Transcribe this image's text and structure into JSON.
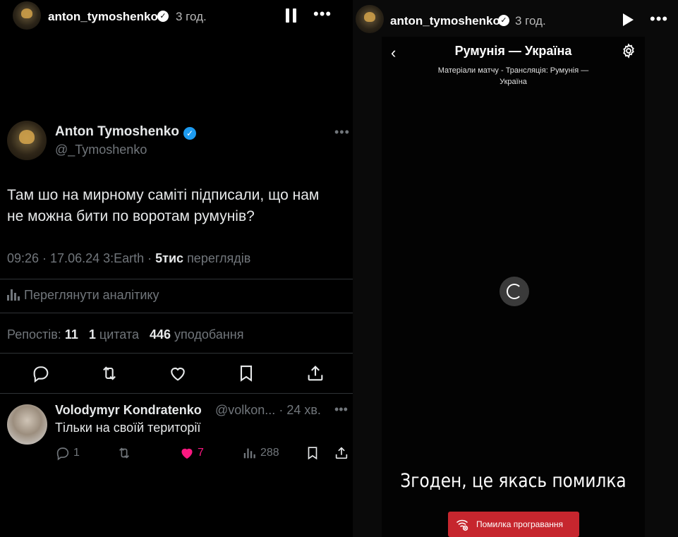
{
  "left_story": {
    "username": "anton_tymoshenko",
    "time": "3 год."
  },
  "tweet": {
    "name": "Anton Tymoshenko",
    "handle": "@_Tymoshenko",
    "text_line1": "Там шо на мирному саміті підписали, що нам",
    "text_line2": "не можна бити по воротам румунів?",
    "meta_prefix": "09:26 · 17.06.24 3:Earth · ",
    "views_count": "5тис",
    "views_label": "переглядів",
    "analytics_label": "Переглянути аналітику",
    "reposts_label": "Репостів:",
    "reposts_count": "11",
    "quotes_count": "1",
    "quotes_label": "цитата",
    "likes_count": "446",
    "likes_label": "уподобання"
  },
  "reply": {
    "name": "Volodymyr Kondratenko",
    "handle": "@volkon...",
    "time": "· 24 хв.",
    "text": "Тільки на своїй території",
    "replies": "1",
    "likes": "7",
    "views": "288"
  },
  "right_story": {
    "username": "anton_tymoshenko",
    "time": "3 год.",
    "video_title": "Румунія — Україна",
    "video_subtitle_line1": "Матеріали матчу - Трансляція: Румунія —",
    "video_subtitle_line2": "Україна",
    "caption": "Згоден, це якась помилка",
    "error_label": "Помилка програвання"
  },
  "colors": {
    "accent_blue": "#1d9bf0",
    "like_pink": "#f91880",
    "error_red": "#c6262e"
  }
}
